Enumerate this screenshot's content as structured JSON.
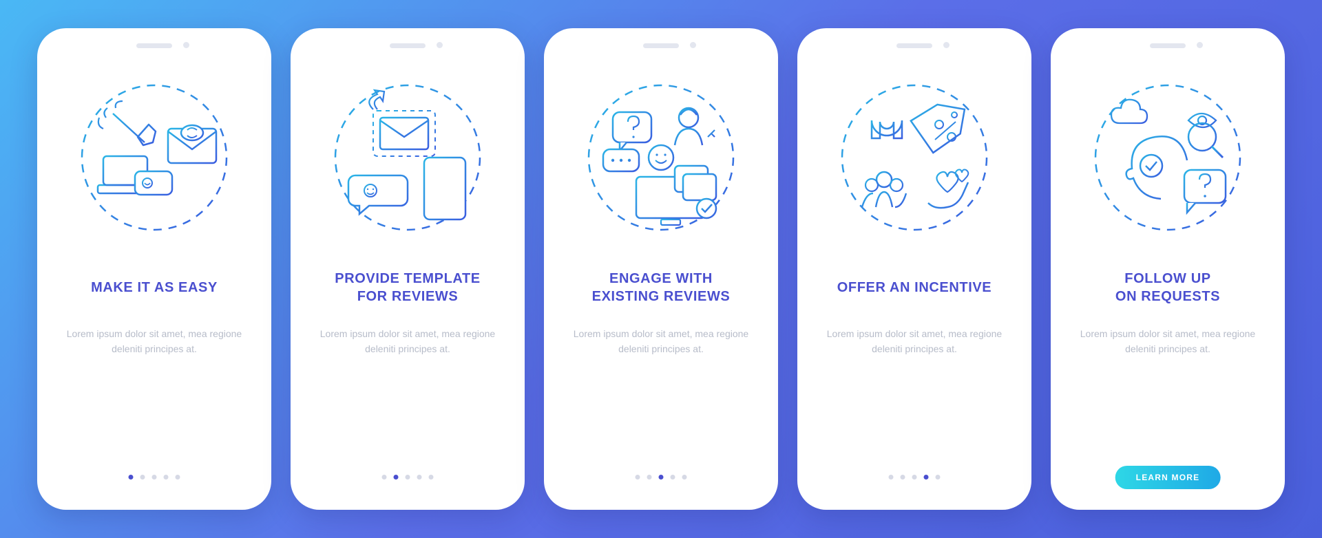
{
  "body_text": "Lorem ipsum dolor sit amet, mea regione deleniti principes at.",
  "learn_more_label": "LEARN MORE",
  "colors": {
    "bg_start": "#4AB8F5",
    "bg_end": "#4A5FDB",
    "title": "#4A4FCF",
    "body": "#b7bcc9",
    "dot_inactive": "#d6d9e5",
    "dot_active": "#4A4FCF",
    "cta_start": "#2ED7E6",
    "cta_end": "#1FA9E6",
    "icon_stroke_a": "#2AB5E6",
    "icon_stroke_b": "#3A5DE0"
  },
  "screens": [
    {
      "title": "MAKE IT AS EASY",
      "icon": "easy-icon"
    },
    {
      "title": "PROVIDE TEMPLATE\nFOR REVIEWS",
      "icon": "template-icon"
    },
    {
      "title": "ENGAGE WITH\nEXISTING REVIEWS",
      "icon": "engage-icon"
    },
    {
      "title": "OFFER AN INCENTIVE",
      "icon": "incentive-icon"
    },
    {
      "title": "FOLLOW UP\nON REQUESTS",
      "icon": "followup-icon"
    }
  ]
}
